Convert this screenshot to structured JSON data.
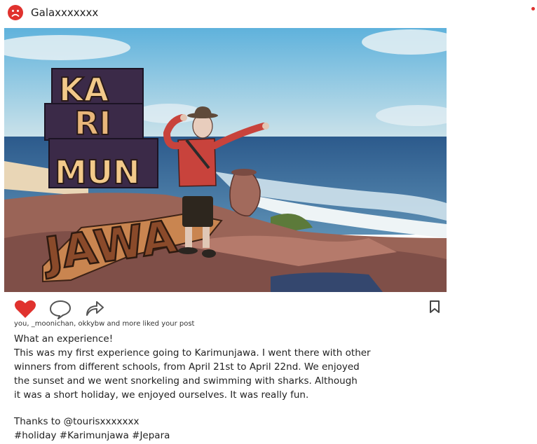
{
  "user": {
    "name": "Galaxxxxxxx",
    "avatar_icon": "sad-face-icon"
  },
  "post": {
    "image_alt": "Karimunjawa",
    "sign_text": [
      "KA",
      "RI",
      "MUN",
      "JAWA"
    ],
    "likes_text": "you, _moonichan, okkybw and more liked your post",
    "caption_title": "What an experience!",
    "caption_lines": [
      "This was my first experience going to Karimunjawa. I went there with other",
      "winners from different schools, from April 21st to April 22nd. We enjoyed",
      "the sunset and we went snorkeling and swimming with sharks. Although",
      "it was a short holiday, we enjoyed ourselves. It was really fun."
    ],
    "thanks": "Thanks to @tourisxxxxxxx",
    "hashtags": "#holiday #Karimunjawa #Jepara"
  },
  "actions": {
    "like_icon": "heart-icon",
    "comment_icon": "comment-icon",
    "share_icon": "share-icon",
    "save_icon": "bookmark-icon",
    "liked": true
  },
  "colors": {
    "accent": "#e0322e",
    "text": "#222222"
  }
}
